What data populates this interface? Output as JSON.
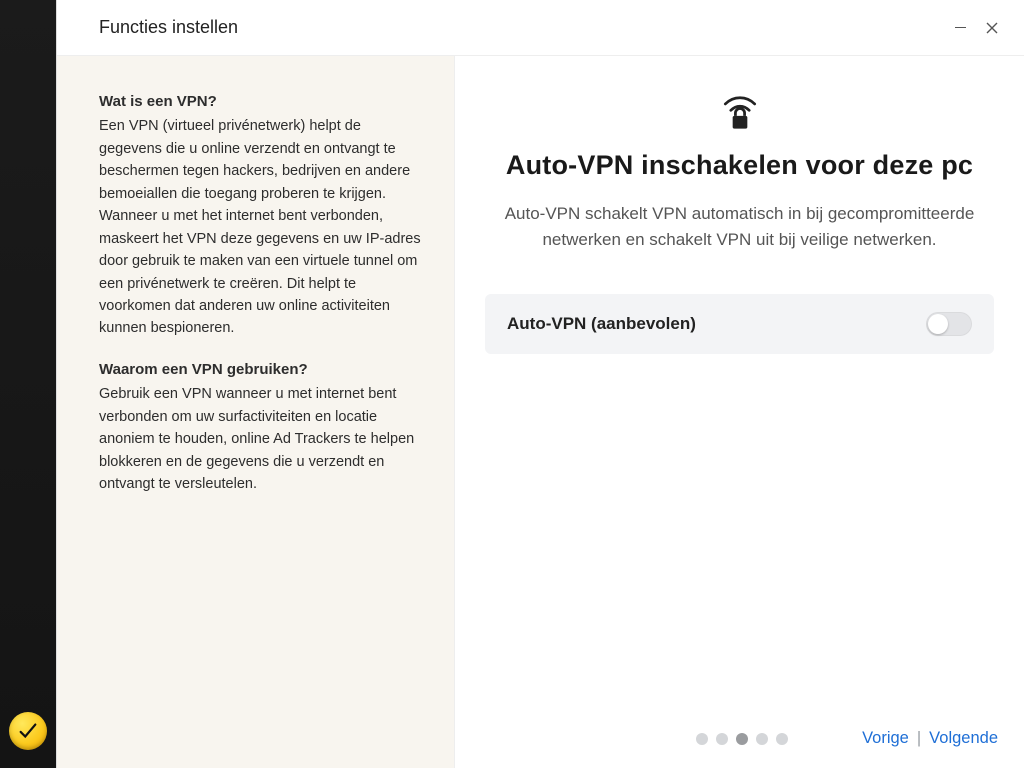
{
  "titlebar": {
    "title": "Functies instellen"
  },
  "side": {
    "q1_title": "Wat is een VPN?",
    "q1_body": "Een VPN (virtueel privénetwerk) helpt de gegevens die u online verzendt en ontvangt te beschermen tegen hackers, bedrijven en andere bemoeiallen die toegang proberen te krijgen. Wanneer u met het internet bent verbonden, maskeert het VPN deze gegevens en uw IP-adres door gebruik te maken van een virtuele tunnel om een privénetwerk te creëren. Dit helpt te voorkomen dat anderen uw online activiteiten kunnen bespioneren.",
    "q2_title": "Waarom een VPN gebruiken?",
    "q2_body": "Gebruik een VPN wanneer u met internet bent verbonden om uw surfactiviteiten en locatie anoniem te houden, online Ad Trackers te helpen blokkeren en de gegevens die u verzendt en ontvangt te versleutelen."
  },
  "main": {
    "heading": "Auto-VPN inschakelen voor deze pc",
    "subheading": "Auto-VPN schakelt VPN automatisch in bij gecompromitteerde netwerken en schakelt VPN uit bij veilige netwerken.",
    "setting_label": "Auto-VPN (aanbevolen)",
    "toggle_on": false
  },
  "footer": {
    "step_count": 5,
    "active_step": 3,
    "prev": "Vorige",
    "next": "Volgende"
  }
}
